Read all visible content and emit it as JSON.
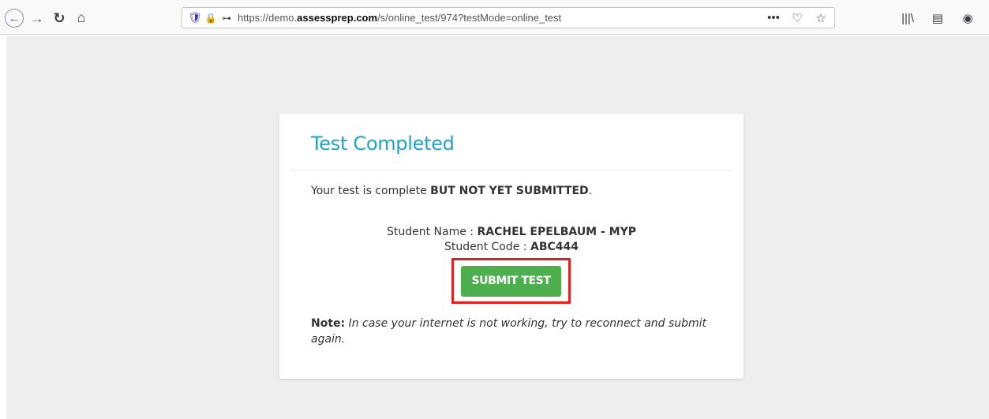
{
  "browser": {
    "url_prefix": "https://demo.",
    "url_domain": "assessprep.com",
    "url_path": "/s/online_test/974?testMode=online_test",
    "icons": {
      "back": "←",
      "forward": "→",
      "reload": "↻",
      "home": "⌂",
      "shield": "🛡",
      "lock": "🔒",
      "permissions": "⊶",
      "more": "•••",
      "pocket": "♡",
      "bookmark": "☆",
      "library": "|||\\",
      "sidebar": "▤",
      "account": "◉"
    }
  },
  "card": {
    "title": "Test Completed",
    "message_prefix": "Your test is complete ",
    "message_bold": "BUT NOT YET SUBMITTED",
    "message_suffix": ".",
    "student_name_label": "Student Name : ",
    "student_name_value": "RACHEL EPELBAUM - MYP",
    "student_code_label": "Student Code : ",
    "student_code_value": "ABC444",
    "submit_label": "SUBMIT TEST",
    "note_label": "Note:",
    "note_text": " In case your internet is not working, try to reconnect and submit again."
  },
  "colors": {
    "title": "#1fa3c5",
    "submit_button": "#4cae4c",
    "highlight_box": "#e0201f",
    "page_background": "#eeeeee"
  }
}
